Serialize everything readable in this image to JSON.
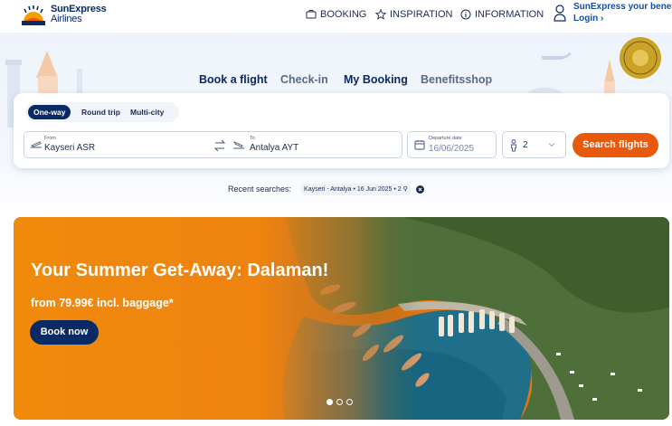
{
  "brand": {
    "line1": "SunExpress",
    "line2": "Airlines"
  },
  "topnav": {
    "booking": "BOOKING",
    "inspiration": "INSPIRATION",
    "information": "INFORMATION"
  },
  "account": {
    "title": "SunExpress your benefits",
    "login": "Login"
  },
  "tabs": [
    {
      "label": "Book a flight"
    },
    {
      "label": "Check-in"
    },
    {
      "label": "My Booking"
    },
    {
      "label": "Benefitsshop"
    }
  ],
  "search": {
    "trip_types": [
      "One-way",
      "Round trip",
      "Multi-city"
    ],
    "selected_trip_type": "One-way",
    "from_label": "From",
    "from_value": "Kayseri ASR",
    "to_label": "To",
    "to_value": "Antalya AYT",
    "date_label": "Departure date",
    "date_value": "16/06/2025",
    "passengers": "2",
    "button": "Search flights"
  },
  "recent": {
    "label": "Recent searches:",
    "items": [
      "Kayseri - Antalya • 16 Jun 2025 • 2"
    ]
  },
  "banner": {
    "title": "Your Summer Get-Away: Dalaman!",
    "subtitle": "from 79.99€ incl. baggage*",
    "button": "Book now",
    "slides": 3,
    "active_slide": 1
  },
  "colors": {
    "navy": "#0a2a66",
    "orange": "#e8590c",
    "link_blue": "#0a4fb3"
  },
  "icons": [
    "sun-logo-icon",
    "briefcase-icon",
    "star-icon",
    "info-icon",
    "person-icon",
    "chevron-right-icon",
    "plane-takeoff-icon",
    "swap-icon",
    "plane-landing-icon",
    "calendar-icon",
    "passenger-icon",
    "chevron-down-icon",
    "close-icon"
  ]
}
